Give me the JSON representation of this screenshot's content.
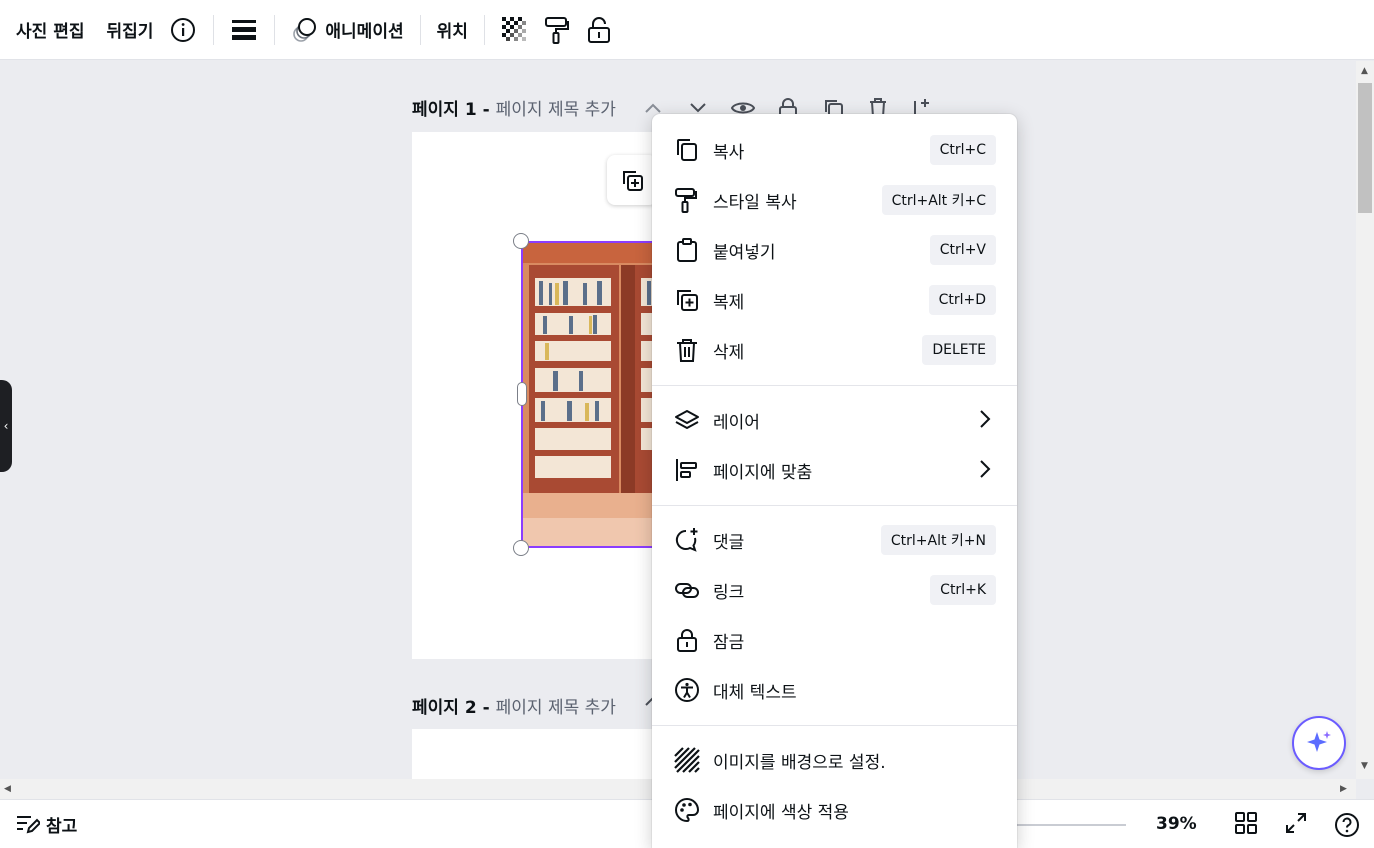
{
  "toolbar": {
    "edit_photo": "사진 편집",
    "flip": "뒤집기",
    "animate": "애니메이션",
    "position": "위치"
  },
  "pages": [
    {
      "name": "페이지 1 -",
      "title_placeholder": "페이지 제목 추가"
    },
    {
      "name": "페이지 2 -",
      "title_placeholder": "페이지 제목 추가"
    }
  ],
  "context_menu": {
    "items": [
      {
        "label": "복사",
        "shortcut": "Ctrl+C",
        "icon": "copy-icon"
      },
      {
        "label": "스타일 복사",
        "shortcut": "Ctrl+Alt 키+C",
        "icon": "paint-roller-icon"
      },
      {
        "label": "붙여넣기",
        "shortcut": "Ctrl+V",
        "icon": "clipboard-icon"
      },
      {
        "label": "복제",
        "shortcut": "Ctrl+D",
        "icon": "duplicate-icon"
      },
      {
        "label": "삭제",
        "shortcut": "DELETE",
        "icon": "trash-icon"
      },
      {
        "label": "레이어",
        "shortcut": "",
        "icon": "layers-icon"
      },
      {
        "label": "페이지에 맞춤",
        "shortcut": "",
        "icon": "align-icon"
      },
      {
        "label": "댓글",
        "shortcut": "Ctrl+Alt 키+N",
        "icon": "comment-icon"
      },
      {
        "label": "링크",
        "shortcut": "Ctrl+K",
        "icon": "link-icon"
      },
      {
        "label": "잠금",
        "shortcut": "",
        "icon": "lock-icon"
      },
      {
        "label": "대체 텍스트",
        "shortcut": "",
        "icon": "accessibility-icon"
      },
      {
        "label": "이미지를 배경으로 설정.",
        "shortcut": "",
        "icon": "background-icon"
      },
      {
        "label": "페이지에 색상 적용",
        "shortcut": "",
        "icon": "palette-icon"
      }
    ]
  },
  "bottom": {
    "notes": "참고",
    "zoom": "39%"
  },
  "colors": {
    "accent": "#8b3dff",
    "canvas_bg": "#ebecf0"
  }
}
